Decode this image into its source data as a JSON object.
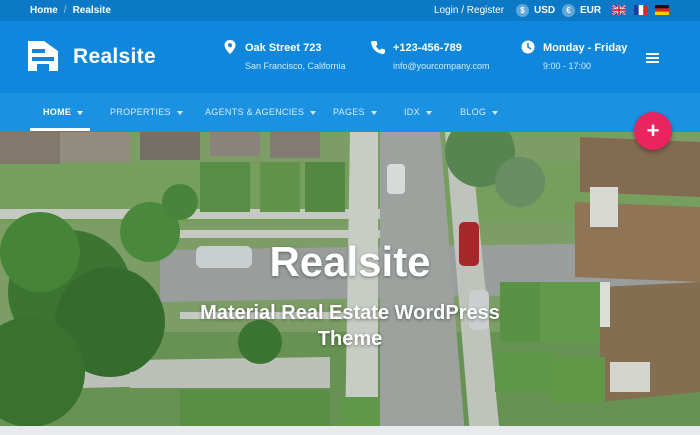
{
  "topbar": {
    "breadcrumb": [
      "Home",
      "Realsite"
    ],
    "separator": "/",
    "login": "Login / Register",
    "currencies": [
      {
        "code": "USD",
        "symbol": "$",
        "icon": "dollar-icon"
      },
      {
        "code": "EUR",
        "symbol": "€",
        "icon": "euro-icon"
      }
    ],
    "flags": [
      "uk-flag-icon",
      "france-flag-icon",
      "germany-flag-icon"
    ]
  },
  "header": {
    "logo": "Realsite",
    "address": {
      "line1": "Oak Street 723",
      "line2": "San Francisco, California",
      "icon": "location-pin-icon"
    },
    "contact": {
      "line1": "+123-456-789",
      "line2": "info@yourcompany.com",
      "icon": "phone-icon"
    },
    "hours": {
      "line1": "Monday - Friday",
      "line2": "9:00 - 17:00",
      "icon": "clock-icon"
    },
    "menu_icon": "hamburger-menu-icon"
  },
  "nav": {
    "items": [
      {
        "label": "HOME",
        "active": true
      },
      {
        "label": "PROPERTIES",
        "active": false
      },
      {
        "label": "AGENTS & AGENCIES",
        "active": false
      },
      {
        "label": "PAGES",
        "active": false
      },
      {
        "label": "IDX",
        "active": false
      },
      {
        "label": "BLOG",
        "active": false
      }
    ]
  },
  "hero": {
    "title": "Realsite",
    "subtitle": "Material Real Estate WordPress Theme",
    "fab_label": "+"
  },
  "colors": {
    "topbar": "#0b79c6",
    "header": "#0e87dc",
    "nav": "#1b91e2",
    "fab": "#e9245e"
  }
}
